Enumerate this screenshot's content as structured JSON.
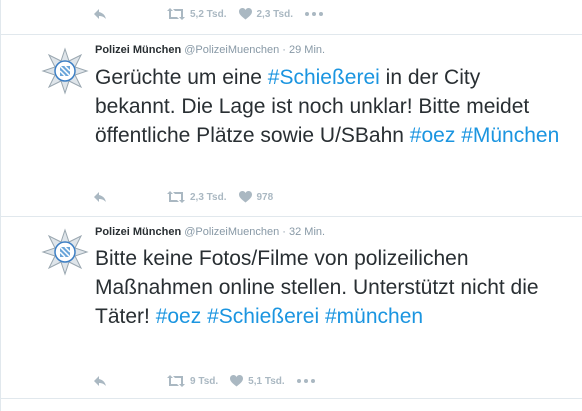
{
  "top_tweet": {
    "retweet_count": "5,2 Tsd.",
    "like_count": "2,3 Tsd."
  },
  "tweets": [
    {
      "author_name": "Polizei München",
      "author_handle": "@PolizeiMuenchen",
      "separator": "·",
      "time": "29 Min.",
      "text_parts": [
        {
          "text": "Gerüchte  um eine ",
          "hashtag": false
        },
        {
          "text": "#Schießerei",
          "hashtag": true
        },
        {
          "text": " in der City bekannt. Die Lage ist noch unklar! Bitte meidet öffentliche Plätze sowie U/SBahn ",
          "hashtag": false
        },
        {
          "text": "#oez",
          "hashtag": true
        },
        {
          "text": " ",
          "hashtag": false
        },
        {
          "text": "#München",
          "hashtag": true
        }
      ],
      "retweet_count": "2,3 Tsd.",
      "like_count": "978"
    },
    {
      "author_name": "Polizei München",
      "author_handle": "@PolizeiMuenchen",
      "separator": "·",
      "time": "32 Min.",
      "text_parts": [
        {
          "text": "Bitte keine Fotos/Filme von polizeilichen Maßnahmen online stellen. Unterstützt nicht die Täter! ",
          "hashtag": false
        },
        {
          "text": "#oez",
          "hashtag": true
        },
        {
          "text": " ",
          "hashtag": false
        },
        {
          "text": "#Schießerei",
          "hashtag": true
        },
        {
          "text": " ",
          "hashtag": false
        },
        {
          "text": "#münchen",
          "hashtag": true
        }
      ],
      "retweet_count": "9 Tsd.",
      "like_count": "5,1 Tsd."
    }
  ],
  "icons": {
    "reply": "reply-icon",
    "retweet": "retweet-icon",
    "like": "heart-icon",
    "more": "more-icon",
    "avatar": "police-star-badge"
  },
  "colors": {
    "text": "#292f33",
    "hashtag": "#1b95e0",
    "meta": "#8899a6",
    "action_icon": "#aab8c2",
    "divider": "#e1e8ed"
  }
}
